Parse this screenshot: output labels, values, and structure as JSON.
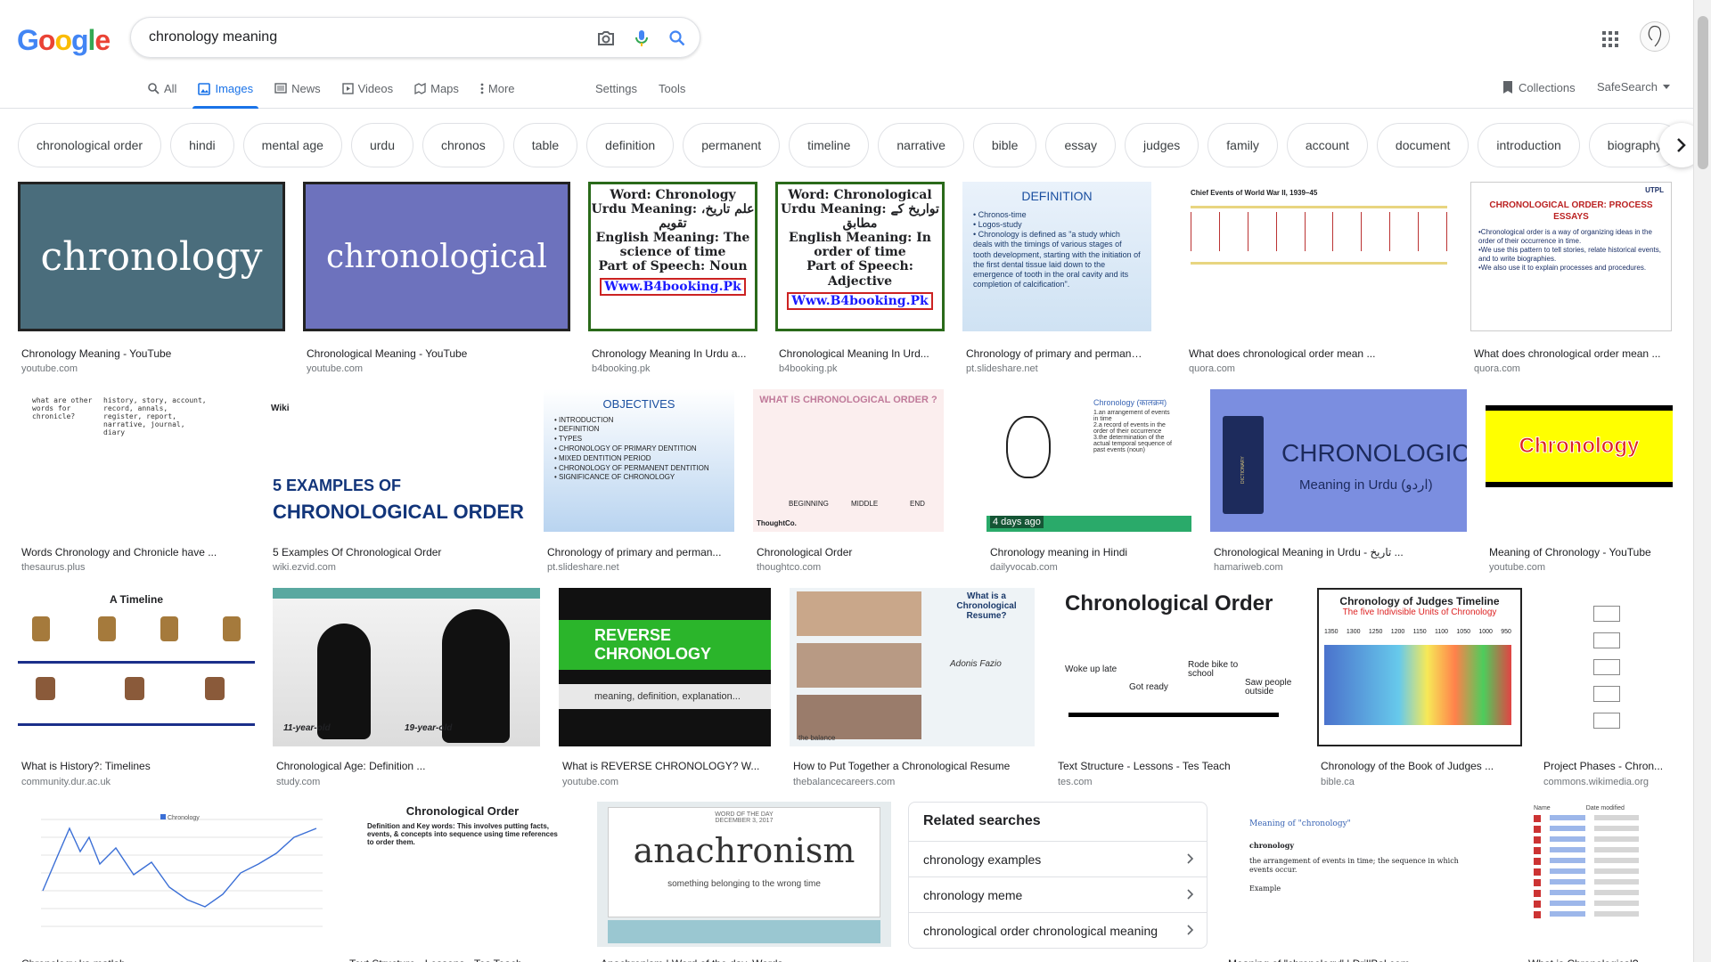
{
  "logo": {
    "letters": [
      "G",
      "o",
      "o",
      "g",
      "l",
      "e"
    ],
    "colors": [
      "#4285f4",
      "#ea4335",
      "#fbbc05",
      "#4285f4",
      "#34a853",
      "#ea4335"
    ]
  },
  "search": {
    "value": "chronology meaning"
  },
  "tabs": [
    {
      "label": "All",
      "icon": "search-icon"
    },
    {
      "label": "Images",
      "icon": "image-icon",
      "active": true
    },
    {
      "label": "News",
      "icon": "news-icon"
    },
    {
      "label": "Videos",
      "icon": "video-icon"
    },
    {
      "label": "Maps",
      "icon": "map-icon"
    },
    {
      "label": "More",
      "icon": "more-vert-icon"
    }
  ],
  "tools": {
    "settings": "Settings",
    "tools": "Tools",
    "collections": "Collections",
    "safesearch": "SafeSearch"
  },
  "chips": [
    "chronological order",
    "hindi",
    "mental age",
    "urdu",
    "chronos",
    "table",
    "definition",
    "permanent",
    "timeline",
    "narrative",
    "bible",
    "essay",
    "judges",
    "family",
    "account",
    "document",
    "introduction",
    "biography"
  ],
  "results": [
    {
      "caption": "Chronology Meaning - YouTube",
      "source": "youtube.com",
      "thumb_text": "chronology"
    },
    {
      "caption": "Chronological Meaning - YouTube",
      "source": "youtube.com",
      "thumb_text": "chronological"
    },
    {
      "caption": "Chronology Meaning In Urdu a...",
      "source": "b4booking.pk",
      "thumb_lines": [
        "Word: Chronology",
        "Urdu Meaning: علم تاریخ، تقویم",
        "English Meaning: The",
        "science of time",
        "Part of Speech: Noun",
        "Www.B4booking.Pk"
      ]
    },
    {
      "caption": "Chronological Meaning In Urd...",
      "source": "b4booking.pk",
      "thumb_lines": [
        "Word: Chronological",
        "Urdu Meaning: تواریخ کے مطابق",
        "English Meaning: In order of time",
        "Part of Speech: Adjective",
        "Www.B4booking.Pk"
      ]
    },
    {
      "caption": "Chronology of primary and permanent...",
      "source": "pt.slideshare.net",
      "thumb_lines": [
        "DEFINITION",
        "• Chronos-time",
        "• Logos-study",
        "• Chronology is defined as \"a study which deals with the timings of various stages of tooth development, starting with the initiation of the first dental tissue laid down to the emergence of tooth in the oral cavity and its completion of calcification\"."
      ]
    },
    {
      "caption": "What does chronological order mean ...",
      "source": "quora.com",
      "thumb_lines": [
        "Chief Events of World War II, 1939–45"
      ]
    },
    {
      "caption": "What does chronological order mean ...",
      "source": "quora.com",
      "thumb_lines": [
        "UTPL",
        "CHRONOLOGICAL ORDER: PROCESS ESSAYS",
        "•Chronological order is a way of organizing ideas in the order of their occurrence in time.",
        "•We use this pattern to tell stories, relate historical events, and to write biographies.",
        "•We also use it to explain processes and procedures."
      ]
    },
    {
      "caption": "Words Chronology and Chronicle have ...",
      "source": "thesaurus.plus",
      "thumb_lines": [
        "what are other words for chronicle?",
        "history, story, account, record, annals, register, report, narrative, journal, diary"
      ]
    },
    {
      "caption": "5 Examples Of Chronological Order",
      "source": "wiki.ezvid.com",
      "thumb_lines": [
        "Wiki",
        "5 EXAMPLES OF",
        "CHRONOLOGICAL ORDER"
      ]
    },
    {
      "caption": "Chronology of primary and perman...",
      "source": "pt.slideshare.net",
      "thumb_lines": [
        "OBJECTIVES",
        "• INTRODUCTION",
        "• DEFINITION",
        "• TYPES",
        "• CHRONOLOGY OF PRIMARY DENTITION",
        "• MIXED DENTITION PERIOD",
        "• CHRONOLOGY OF PERMANENT DENTITION",
        "• SIGNIFICANCE OF CHRONOLOGY"
      ]
    },
    {
      "caption": "Chronological Order",
      "source": "thoughtco.com",
      "thumb_lines": [
        "WHAT IS CHRONOLOGICAL ORDER ?",
        "BEGINNING",
        "MIDDLE",
        "END",
        "ThoughtCo."
      ]
    },
    {
      "caption": "Chronology meaning in Hindi",
      "source": "dailyvocab.com",
      "badge": "4 days ago",
      "thumb_lines": [
        "Chronology (कालक्रम)",
        "1.an arrangement of events in time",
        "2.a record of events in the order of their occurrence",
        "3.the determination of the actual temporal sequence of past events (noun)"
      ]
    },
    {
      "caption": "Chronological Meaning in Urdu - تاریخ ...",
      "source": "hamariweb.com",
      "thumb_lines": [
        "CHRONOLOGICAL",
        "Meaning in Urdu (اردو)",
        "DICTIONARY"
      ]
    },
    {
      "caption": "Meaning of Chronology - YouTube",
      "source": "youtube.com",
      "thumb_lines": [
        "Chronology"
      ]
    },
    {
      "caption": "What is History?: Timelines",
      "source": "community.dur.ac.uk",
      "thumb_lines": [
        "A Timeline"
      ]
    },
    {
      "caption": "Chronological Age: Definition ...",
      "source": "study.com",
      "thumb_lines": [
        "11-year-old",
        "19-year-old"
      ]
    },
    {
      "caption": "What is REVERSE CHRONOLOGY? W...",
      "source": "youtube.com",
      "thumb_lines": [
        "REVERSE CHRONOLOGY",
        "meaning, definition, explanation..."
      ]
    },
    {
      "caption": "How to Put Together a Chronological Resume",
      "source": "thebalancecareers.com",
      "thumb_lines": [
        "What is a Chronological Resume?",
        "Adonis Fazio",
        "the balance"
      ]
    },
    {
      "caption": "Text Structure - Lessons - Tes Teach",
      "source": "tes.com",
      "thumb_lines": [
        "Chronological Order",
        "Woke up late",
        "Got ready",
        "Rode bike to school",
        "Saw people outside"
      ]
    },
    {
      "caption": "Chronology of the Book of Judges ...",
      "source": "bible.ca",
      "thumb_lines": [
        "Chronology of Judges Timeline",
        "The five Indivisible Units of Chronology",
        "1350",
        "1300",
        "1250",
        "1200",
        "1150",
        "1100",
        "1050",
        "1000",
        "950"
      ]
    },
    {
      "caption": "Project Phases - Chron...",
      "source": "commons.wikimedia.org",
      "thumb_lines": []
    },
    {
      "caption": "Chronology ka matlab",
      "source": "",
      "thumb_lines": [
        "Chronology"
      ]
    },
    {
      "caption": "Text Structure - Lessons - Tes Teach",
      "source": "",
      "thumb_lines": [
        "Chronological Order",
        "Definition and Key words: This involves putting facts, events, & concepts into sequence using time references to order them."
      ]
    },
    {
      "caption": "Anachronism | Word of the day, Words ...",
      "source": "",
      "thumb_lines": [
        "WORD OF THE DAY",
        "DECEMBER 3, 2017",
        "anachronism",
        "something belonging to the wrong time"
      ]
    },
    {
      "caption": "Meaning of \"chronology\" | DrillBal.com",
      "source": "",
      "thumb_lines": [
        "Meaning of \"chronology\"",
        "chronology",
        "the arrangement of events in time; the sequence in which events occur.",
        "Example"
      ]
    },
    {
      "caption": "What is Chronological?",
      "source": "",
      "thumb_lines": [
        "Name",
        "Date modified"
      ]
    }
  ],
  "related": {
    "title": "Related searches",
    "items": [
      "chronology examples",
      "chronology meme",
      "chronological order chronological meaning"
    ]
  }
}
